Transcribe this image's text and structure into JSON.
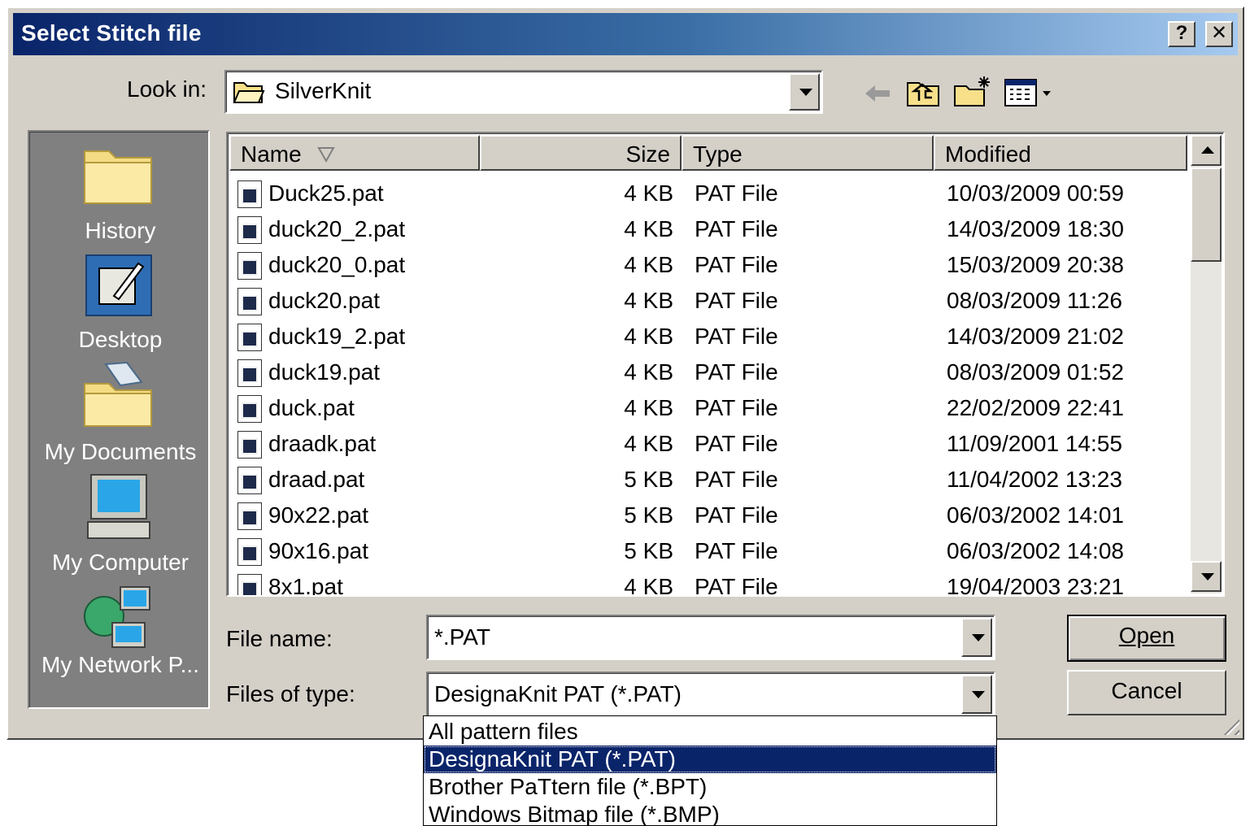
{
  "window": {
    "title": "Select Stitch file",
    "help_label": "?",
    "close_label": "✕"
  },
  "lookin": {
    "label": "Look in:",
    "value": "SilverKnit"
  },
  "places": [
    {
      "label": "History",
      "icon": "history-folder-icon"
    },
    {
      "label": "Desktop",
      "icon": "desktop-icon"
    },
    {
      "label": "My Documents",
      "icon": "my-documents-icon"
    },
    {
      "label": "My Computer",
      "icon": "my-computer-icon"
    },
    {
      "label": "My Network P...",
      "icon": "my-network-places-icon"
    }
  ],
  "columns": {
    "name": "Name",
    "size": "Size",
    "type": "Type",
    "modified": "Modified"
  },
  "files": [
    {
      "name": "Duck25.pat",
      "size": "4 KB",
      "type": "PAT File",
      "modified": "10/03/2009 00:59"
    },
    {
      "name": "duck20_2.pat",
      "size": "4 KB",
      "type": "PAT File",
      "modified": "14/03/2009 18:30"
    },
    {
      "name": "duck20_0.pat",
      "size": "4 KB",
      "type": "PAT File",
      "modified": "15/03/2009 20:38"
    },
    {
      "name": "duck20.pat",
      "size": "4 KB",
      "type": "PAT File",
      "modified": "08/03/2009 11:26"
    },
    {
      "name": "duck19_2.pat",
      "size": "4 KB",
      "type": "PAT File",
      "modified": "14/03/2009 21:02"
    },
    {
      "name": "duck19.pat",
      "size": "4 KB",
      "type": "PAT File",
      "modified": "08/03/2009 01:52"
    },
    {
      "name": "duck.pat",
      "size": "4 KB",
      "type": "PAT File",
      "modified": "22/02/2009 22:41"
    },
    {
      "name": "draadk.pat",
      "size": "4 KB",
      "type": "PAT File",
      "modified": "11/09/2001 14:55"
    },
    {
      "name": "draad.pat",
      "size": "5 KB",
      "type": "PAT File",
      "modified": "11/04/2002 13:23"
    },
    {
      "name": "90x22.pat",
      "size": "5 KB",
      "type": "PAT File",
      "modified": "06/03/2002 14:01"
    },
    {
      "name": "90x16.pat",
      "size": "5 KB",
      "type": "PAT File",
      "modified": "06/03/2002 14:08"
    },
    {
      "name": "8x1.pat",
      "size": "4 KB",
      "type": "PAT File",
      "modified": "19/04/2003 23:21"
    }
  ],
  "filename": {
    "label": "File name:",
    "value": "*.PAT"
  },
  "filetype": {
    "label": "Files of type:",
    "value": "DesignaKnit PAT (*.PAT)",
    "options": [
      "All pattern files",
      "DesignaKnit PAT (*.PAT)",
      "Brother PaTtern file (*.BPT)",
      "Windows Bitmap file (*.BMP)"
    ]
  },
  "buttons": {
    "open": "Open",
    "cancel": "Cancel"
  }
}
